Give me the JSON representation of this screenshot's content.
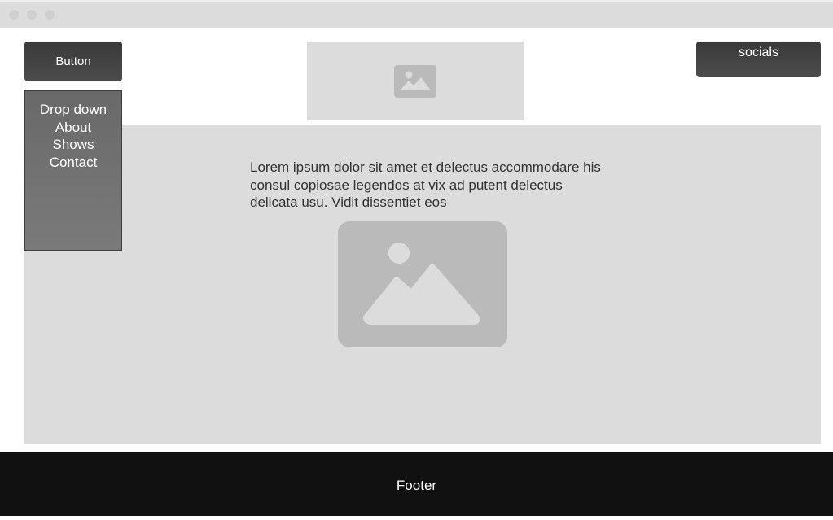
{
  "window": {
    "controls": [
      "close",
      "minimize",
      "maximize"
    ]
  },
  "header": {
    "button_label": "Button",
    "socials_label": "socials",
    "logo_icon": "image-placeholder-icon"
  },
  "dropdown": {
    "items": [
      {
        "label": "Drop down"
      },
      {
        "label": "About"
      },
      {
        "label": "Shows"
      },
      {
        "label": "Contact"
      }
    ]
  },
  "main": {
    "text": "Lorem ipsum dolor sit amet et delectus accommodare his consul copiosae legendos at vix ad putent delectus delicata usu. Vidit dissentiet eos",
    "image_icon": "image-placeholder-icon"
  },
  "footer": {
    "label": "Footer"
  },
  "colors": {
    "button_bg": "#444444",
    "placeholder_bg": "#dcdcdc",
    "dropdown_bg": "#707070",
    "footer_bg": "#111111"
  }
}
